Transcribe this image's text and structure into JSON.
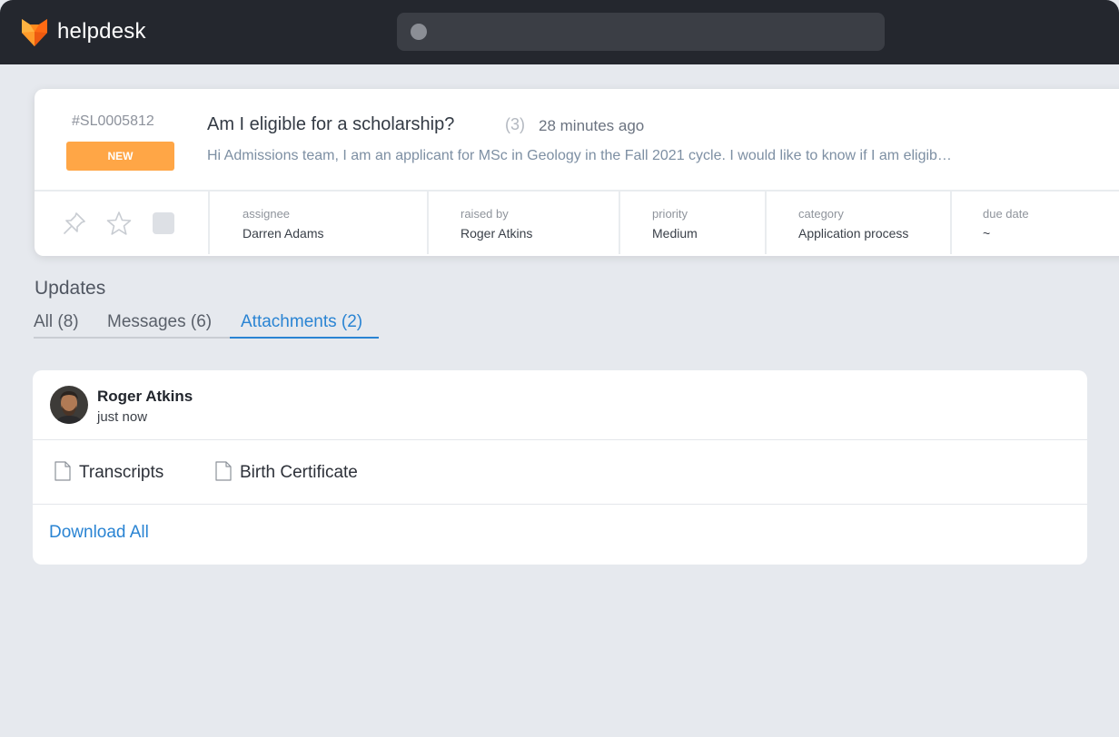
{
  "app": {
    "brand": "helpdesk",
    "logo_icon": "fox-icon",
    "search_placeholder": ""
  },
  "ticket": {
    "id": "#SL0005812",
    "status": "NEW",
    "status_color": "#ffa646",
    "title": "Am I eligible for a scholarship?",
    "reply_count": "(3)",
    "time": "28 minutes ago",
    "preview": "Hi Admissions team, I am an applicant for MSc in Geology in the Fall 2021 cycle. I would like to know if I am eligib…",
    "actions": [
      "pin-icon",
      "star-icon",
      "checkbox"
    ],
    "meta": [
      {
        "label": "assignee",
        "value": "Darren Adams"
      },
      {
        "label": "raised by",
        "value": "Roger Atkins"
      },
      {
        "label": "priority",
        "value": "Medium"
      },
      {
        "label": "category",
        "value": "Application process"
      },
      {
        "label": "due date",
        "value": "~"
      }
    ]
  },
  "updates": {
    "heading": "Updates",
    "tabs": [
      {
        "label": "All (8)",
        "active": false
      },
      {
        "label": "Messages (6)",
        "active": false
      },
      {
        "label": "Attachments (2)",
        "active": true
      }
    ],
    "accent_color": "#2a84d3"
  },
  "attachment_post": {
    "author": "Roger Atkins",
    "time": "just now",
    "files": [
      "Transcripts",
      "Birth Certificate"
    ],
    "download_all": "Download All"
  }
}
